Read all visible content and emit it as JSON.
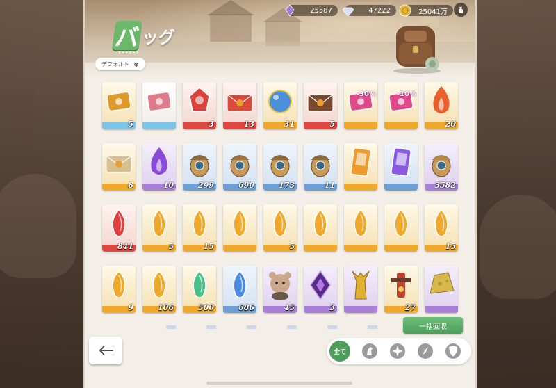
{
  "header": {
    "title_first": "バ",
    "title_rest": "ッグ",
    "title_dots": "••••••",
    "sort_label": "デフォルト"
  },
  "currencies": [
    {
      "name": "purple-crystal",
      "value": "25587",
      "icon": "purple-crystal-icon",
      "color": "#9a7bd8"
    },
    {
      "name": "diamond",
      "value": "47222",
      "icon": "diamond-icon",
      "color": "#c9d6ef"
    },
    {
      "name": "coin",
      "value": "25041万",
      "icon": "coin-icon",
      "color": "#e2b43a"
    }
  ],
  "items": [
    {
      "icon": "ticket-gold-icon",
      "count": "5",
      "rarity": "gold",
      "stripe": "#7ec3e8"
    },
    {
      "icon": "ticket-pink-icon",
      "count": "",
      "rarity": "white",
      "stripe": "#7ec3e8"
    },
    {
      "icon": "red-gem-icon",
      "count": "3",
      "rarity": "red",
      "stripe": "#e0463f"
    },
    {
      "icon": "envelope-gift-icon",
      "count": "13",
      "rarity": "red",
      "stripe": "#e0463f"
    },
    {
      "icon": "blue-orb-icon",
      "count": "31",
      "rarity": "gold",
      "stripe": "#f0a92c"
    },
    {
      "icon": "wrapped-gift-icon",
      "count": "5",
      "rarity": "red",
      "stripe": "#e0463f"
    },
    {
      "icon": "coupon-icon",
      "count": "",
      "rarity": "gold",
      "stripe": "#f0a92c",
      "discount": "-30%"
    },
    {
      "icon": "coupon-icon",
      "count": "",
      "rarity": "gold",
      "stripe": "#f0a92c",
      "discount": "-10%"
    },
    {
      "icon": "flame-crest-icon",
      "count": "20",
      "rarity": "gold",
      "stripe": "#f0a92c"
    },
    {
      "icon": "envelope-icon",
      "count": "8",
      "rarity": "gold",
      "stripe": "#f0a92c"
    },
    {
      "icon": "purple-flame-icon",
      "count": "10",
      "rarity": "purple",
      "stripe": "#a77fd6"
    },
    {
      "icon": "acorn-green-icon",
      "count": "299",
      "rarity": "blue",
      "stripe": "#6d9fd6"
    },
    {
      "icon": "acorn-orange-icon",
      "count": "690",
      "rarity": "blue",
      "stripe": "#6d9fd6"
    },
    {
      "icon": "acorn-leaf-icon",
      "count": "173",
      "rarity": "blue",
      "stripe": "#6d9fd6"
    },
    {
      "icon": "acorn-star-icon",
      "count": "11",
      "rarity": "blue",
      "stripe": "#6d9fd6"
    },
    {
      "icon": "orange-card-icon",
      "count": "",
      "rarity": "gold",
      "stripe": "#f0a92c"
    },
    {
      "icon": "purple-card-icon",
      "count": "",
      "rarity": "blue",
      "stripe": "#6d9fd6"
    },
    {
      "icon": "acorn-plain-icon",
      "count": "3582",
      "rarity": "purple",
      "stripe": "#a77fd6"
    },
    {
      "icon": "red-leaf-gem-icon",
      "count": "841",
      "rarity": "red",
      "stripe": "#e0463f"
    },
    {
      "icon": "gold-leaf-gem-icon",
      "count": "5",
      "rarity": "gold",
      "stripe": "#f0a92c"
    },
    {
      "icon": "gold-leaf-gem-icon",
      "count": "15",
      "rarity": "gold",
      "stripe": "#f0a92c"
    },
    {
      "icon": "gold-leaf-gem-icon",
      "count": "",
      "rarity": "gold",
      "stripe": "#f0a92c"
    },
    {
      "icon": "gold-leaf-gem-icon",
      "count": "5",
      "rarity": "gold",
      "stripe": "#f0a92c"
    },
    {
      "icon": "gold-leaf-gem-icon",
      "count": "",
      "rarity": "gold",
      "stripe": "#f0a92c"
    },
    {
      "icon": "gold-leaf-gem-icon",
      "count": "",
      "rarity": "gold",
      "stripe": "#f0a92c"
    },
    {
      "icon": "gold-leaf-gem-icon",
      "count": "",
      "rarity": "gold",
      "stripe": "#f0a92c"
    },
    {
      "icon": "gold-leaf-gem-icon",
      "count": "15",
      "rarity": "gold",
      "stripe": "#f0a92c"
    },
    {
      "icon": "gold-leaf-gem-icon",
      "count": "9",
      "rarity": "gold",
      "stripe": "#f0a92c"
    },
    {
      "icon": "gold-leaf-gem-icon",
      "count": "106",
      "rarity": "gold",
      "stripe": "#f0a92c"
    },
    {
      "icon": "green-leaf-gem-icon",
      "count": "500",
      "rarity": "gold",
      "stripe": "#f0a92c"
    },
    {
      "icon": "blue-leaf-gem-icon",
      "count": "686",
      "rarity": "blue",
      "stripe": "#6d9fd6"
    },
    {
      "icon": "bear-plush-icon",
      "count": "45",
      "rarity": "purple",
      "stripe": "#a77fd6"
    },
    {
      "icon": "dark-crystal-icon",
      "count": "3",
      "rarity": "purple",
      "stripe": "#a77fd6"
    },
    {
      "icon": "gold-deer-icon",
      "count": "",
      "rarity": "purple",
      "stripe": "#a77fd6"
    },
    {
      "icon": "lantern-totem-icon",
      "count": "27",
      "rarity": "gold",
      "stripe": "#f0a92c"
    },
    {
      "icon": "cheese-bundle-icon",
      "count": "",
      "rarity": "purple",
      "stripe": "#a77fd6"
    }
  ],
  "buttons": {
    "collect_all": "一括回収",
    "filter_all": "全て"
  },
  "filters": [
    {
      "name": "filter-horse-icon"
    },
    {
      "name": "filter-star-icon"
    },
    {
      "name": "filter-compass-icon"
    },
    {
      "name": "filter-shield-icon"
    }
  ]
}
